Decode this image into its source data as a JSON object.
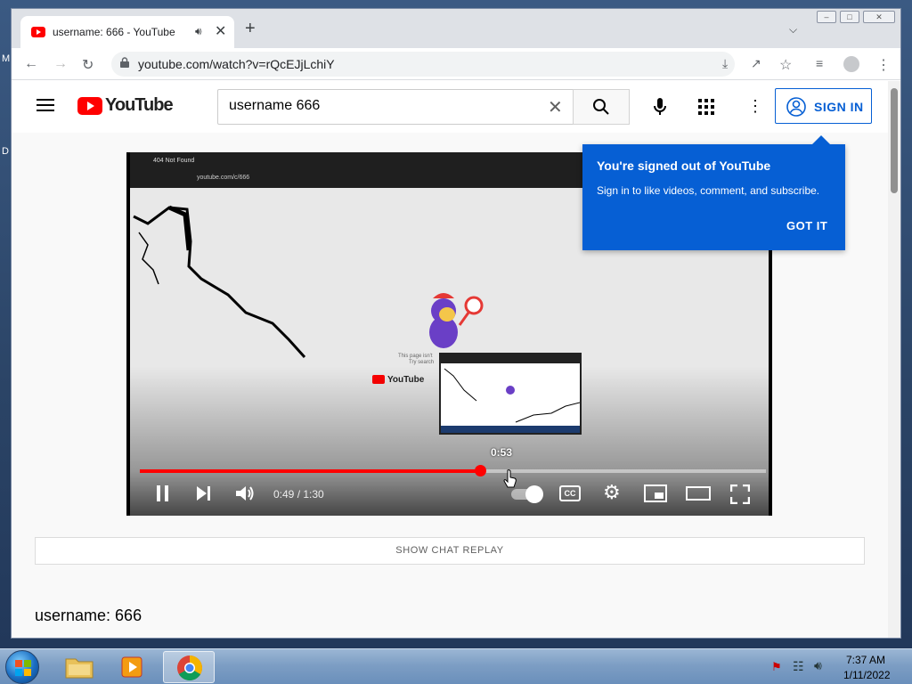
{
  "desktop": {
    "left_letters": [
      "M",
      "D"
    ]
  },
  "browser": {
    "tab_title": "username: 666 - YouTube",
    "url": "youtube.com/watch?v=rQcEJjLchiY"
  },
  "youtube": {
    "search_query": "username 666",
    "sign_in_label": "SIGN IN",
    "popup": {
      "title": "You're signed out of YouTube",
      "text": "Sign in to like videos, comment, and subscribe.",
      "button": "GOT IT"
    },
    "player": {
      "current_time": "0:49",
      "duration": "1:30",
      "time_display": "0:49 / 1:30",
      "preview_time": "0:53",
      "progress_fraction": 0.544
    },
    "chat_replay_label": "SHOW CHAT REPLAY",
    "video_title": "username: 666",
    "inner_video": {
      "tab_title": "404 Not Found",
      "url": "youtube.com/c/666",
      "logo_text": "YouTube",
      "message_1": "This page isn't",
      "message_2": "Try search"
    }
  },
  "taskbar": {
    "time": "7:37 AM",
    "date": "1/11/2022"
  },
  "colors": {
    "youtube_red": "#ff0000",
    "popup_blue": "#065fd4",
    "taskbar": "#7d9ec4"
  }
}
